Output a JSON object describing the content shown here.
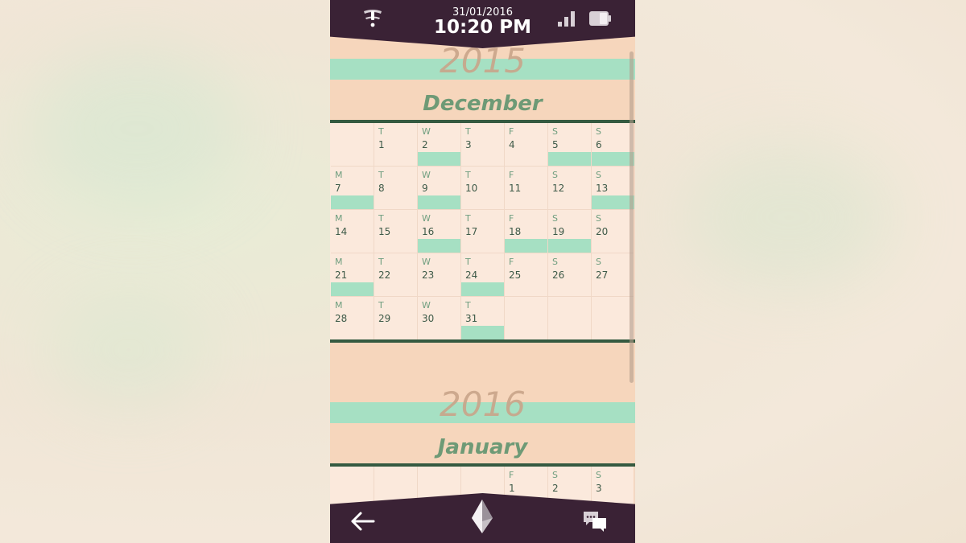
{
  "status_bar": {
    "date": "31/01/2016",
    "time": "10:20 PM"
  },
  "icons": {
    "notification": "alert-tower-icon",
    "signal": "signal-bars-icon",
    "battery": "battery-icon",
    "back": "back-arrow-icon",
    "home": "crystal-icon",
    "messages": "chat-bubbles-icon"
  },
  "colors": {
    "bar": "#3a2235",
    "accent_mint": "#a6e0c3",
    "peach": "#f6d6bc",
    "month_green": "#6e9a76"
  },
  "calendar": {
    "sections": [
      {
        "year": "2015",
        "month": "December",
        "cells": [
          {
            "dow": "",
            "day": "",
            "mark": false
          },
          {
            "dow": "T",
            "day": "1",
            "mark": false
          },
          {
            "dow": "W",
            "day": "2",
            "mark": true
          },
          {
            "dow": "T",
            "day": "3",
            "mark": false
          },
          {
            "dow": "F",
            "day": "4",
            "mark": false
          },
          {
            "dow": "S",
            "day": "5",
            "mark": true
          },
          {
            "dow": "S",
            "day": "6",
            "mark": true
          },
          {
            "dow": "M",
            "day": "7",
            "mark": true
          },
          {
            "dow": "T",
            "day": "8",
            "mark": false
          },
          {
            "dow": "W",
            "day": "9",
            "mark": true
          },
          {
            "dow": "T",
            "day": "10",
            "mark": false
          },
          {
            "dow": "F",
            "day": "11",
            "mark": false
          },
          {
            "dow": "S",
            "day": "12",
            "mark": false
          },
          {
            "dow": "S",
            "day": "13",
            "mark": true
          },
          {
            "dow": "M",
            "day": "14",
            "mark": false
          },
          {
            "dow": "T",
            "day": "15",
            "mark": false
          },
          {
            "dow": "W",
            "day": "16",
            "mark": true
          },
          {
            "dow": "T",
            "day": "17",
            "mark": false
          },
          {
            "dow": "F",
            "day": "18",
            "mark": true
          },
          {
            "dow": "S",
            "day": "19",
            "mark": true
          },
          {
            "dow": "S",
            "day": "20",
            "mark": false
          },
          {
            "dow": "M",
            "day": "21",
            "mark": true
          },
          {
            "dow": "T",
            "day": "22",
            "mark": false
          },
          {
            "dow": "W",
            "day": "23",
            "mark": false
          },
          {
            "dow": "T",
            "day": "24",
            "mark": true
          },
          {
            "dow": "F",
            "day": "25",
            "mark": false
          },
          {
            "dow": "S",
            "day": "26",
            "mark": false
          },
          {
            "dow": "S",
            "day": "27",
            "mark": false
          },
          {
            "dow": "M",
            "day": "28",
            "mark": false
          },
          {
            "dow": "T",
            "day": "29",
            "mark": false
          },
          {
            "dow": "W",
            "day": "30",
            "mark": false
          },
          {
            "dow": "T",
            "day": "31",
            "mark": true
          },
          {
            "dow": "",
            "day": "",
            "mark": false
          },
          {
            "dow": "",
            "day": "",
            "mark": false
          },
          {
            "dow": "",
            "day": "",
            "mark": false
          }
        ]
      },
      {
        "year": "2016",
        "month": "January",
        "cells": [
          {
            "dow": "",
            "day": "",
            "mark": false
          },
          {
            "dow": "",
            "day": "",
            "mark": false
          },
          {
            "dow": "",
            "day": "",
            "mark": false
          },
          {
            "dow": "",
            "day": "",
            "mark": false
          },
          {
            "dow": "F",
            "day": "1",
            "mark": false
          },
          {
            "dow": "S",
            "day": "2",
            "mark": false
          },
          {
            "dow": "S",
            "day": "3",
            "mark": false
          }
        ]
      }
    ]
  }
}
